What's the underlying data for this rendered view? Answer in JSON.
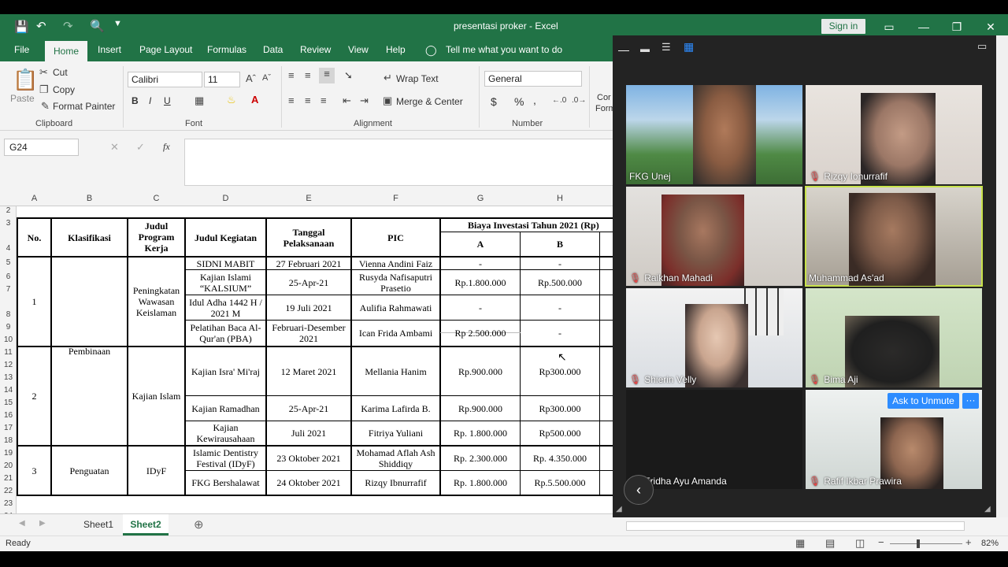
{
  "window": {
    "title": "presentasi proker - Excel",
    "signin": "Sign in",
    "controls": [
      "▭",
      "—",
      "❐",
      "✕"
    ]
  },
  "tabs": [
    "File",
    "Home",
    "Insert",
    "Page Layout",
    "Formulas",
    "Data",
    "Review",
    "View",
    "Help",
    "Tell me what you want to do"
  ],
  "ribbon": {
    "clipboard": {
      "paste": "Paste",
      "cut": "Cut",
      "copy": "Copy",
      "format_painter": "Format Painter",
      "group": "Clipboard"
    },
    "font": {
      "name": "Calibri",
      "size": "11",
      "bold": "B",
      "italic": "I",
      "underline": "U",
      "group": "Font"
    },
    "alignment": {
      "wrap": "Wrap Text",
      "merge": "Merge & Center",
      "group": "Alignment"
    },
    "number": {
      "format": "General",
      "currency": "$",
      "percent": "%",
      "comma": ",",
      "group": "Number"
    },
    "styles": {
      "cond": "Cor",
      "form": "Form"
    }
  },
  "formula_bar": {
    "name_box": "G24",
    "fx": "fx",
    "value": ""
  },
  "columns": [
    "A",
    "B",
    "C",
    "D",
    "E",
    "F",
    "G",
    "H"
  ],
  "rows": [
    "2",
    "3",
    "4",
    "5",
    "6",
    "7",
    "8",
    "9",
    "10",
    "11",
    "12",
    "13",
    "14",
    "15",
    "16",
    "17",
    "18",
    "19",
    "20",
    "21",
    "22",
    "23",
    "24"
  ],
  "table": {
    "headers": {
      "no": "No.",
      "klasifikasi": "Klasifikasi",
      "judul_program": "Judul Program Kerja",
      "judul_kegiatan": "Judul Kegiatan",
      "tanggal": "Tanggal Pelaksanaan",
      "pic": "PIC",
      "biaya": "Biaya Investasi Tahun 2021 (Rp)",
      "a": "A",
      "b": "B"
    },
    "no": [
      "1",
      "2",
      "3"
    ],
    "klasifikasi": [
      "Pembinaan",
      "Penguatan"
    ],
    "program": [
      "Peningkatan Wawasan Keislaman",
      "Kajian Islam",
      "IDyF"
    ],
    "rows": [
      {
        "kegiatan": "SIDNI MABIT",
        "tanggal": "27 Februari 2021",
        "pic": "Vienna Andini Faiz",
        "a": "-",
        "b": "-"
      },
      {
        "kegiatan": "Kajian Islami “KALSIUM”",
        "tanggal": "25-Apr-21",
        "pic": "Rusyda Nafisaputri Prasetio",
        "a": "Rp.1.800.000",
        "b": "Rp.500.000"
      },
      {
        "kegiatan": "Idul Adha 1442 H / 2021 M",
        "tanggal": "19 Juli 2021",
        "pic": "Aulifia Rahmawati",
        "a": "-",
        "b": "-"
      },
      {
        "kegiatan": "Pelatihan Baca Al-Qur'an (PBA)",
        "tanggal": "Februari-Desember 2021",
        "pic": "Ican Frida Ambami",
        "a": "Rp 2.500.000",
        "b": "-"
      },
      {
        "kegiatan": "Kajian Isra' Mi'raj",
        "tanggal": "12 Maret 2021",
        "pic": "Mellania Hanim",
        "a": "Rp.900.000",
        "b": "Rp300.000"
      },
      {
        "kegiatan": "Kajian Ramadhan",
        "tanggal": "25-Apr-21",
        "pic": "Karima Lafirda B.",
        "a": "Rp.900.000",
        "b": "Rp300.000"
      },
      {
        "kegiatan": "Kajian Kewirausahaan",
        "tanggal": "Juli 2021",
        "pic": "Fitriya Yuliani",
        "a": "Rp. 1.800.000",
        "b": "Rp500.000"
      },
      {
        "kegiatan": "Islamic Dentistry Festival (IDyF)",
        "tanggal": "23 Oktober 2021",
        "pic": "Mohamad Aflah Ash Shiddiqy",
        "a": "Rp. 2.300.000",
        "b": "Rp. 4.350.000"
      },
      {
        "kegiatan": "FKG Bershalawat",
        "tanggal": "24 Oktober 2021",
        "pic": "Rizqy Ibnurrafif",
        "a": "Rp. 1.800.000",
        "b": "Rp.5.500.000"
      }
    ]
  },
  "sheets": [
    "Sheet1",
    "Sheet2"
  ],
  "status": {
    "ready": "Ready",
    "zoom": "82%"
  },
  "meeting": {
    "participants": [
      "FKG Unej",
      "Rizqy Ionurrafif",
      "Raikhan Mahadi",
      "Muhammad As'ad",
      "Shierin Velly",
      "Bima Aji",
      "Fridha Ayu Amanda",
      "Rafif Ikbar Prawira"
    ],
    "ask_unmute": "Ask to Unmute",
    "more": "···"
  }
}
